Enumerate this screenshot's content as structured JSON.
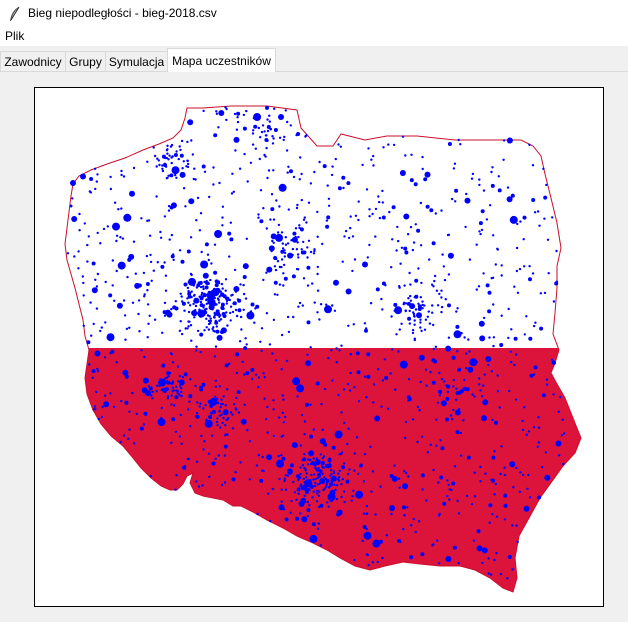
{
  "window": {
    "title": "Bieg niepodległości - bieg-2018.csv",
    "icon": "feather-icon"
  },
  "menu": {
    "items": [
      {
        "label": "Plik"
      }
    ]
  },
  "tabs": [
    {
      "label": "Zawodnicy",
      "active": false
    },
    {
      "label": "Grupy",
      "active": false
    },
    {
      "label": "Symulacja",
      "active": false
    },
    {
      "label": "Mapa uczestników",
      "active": true
    }
  ],
  "map": {
    "flag_colors": {
      "top": "#ffffff",
      "bottom": "#dc143c"
    },
    "outline_color": "#c8102e",
    "marker_color": "#0000ff"
  }
}
